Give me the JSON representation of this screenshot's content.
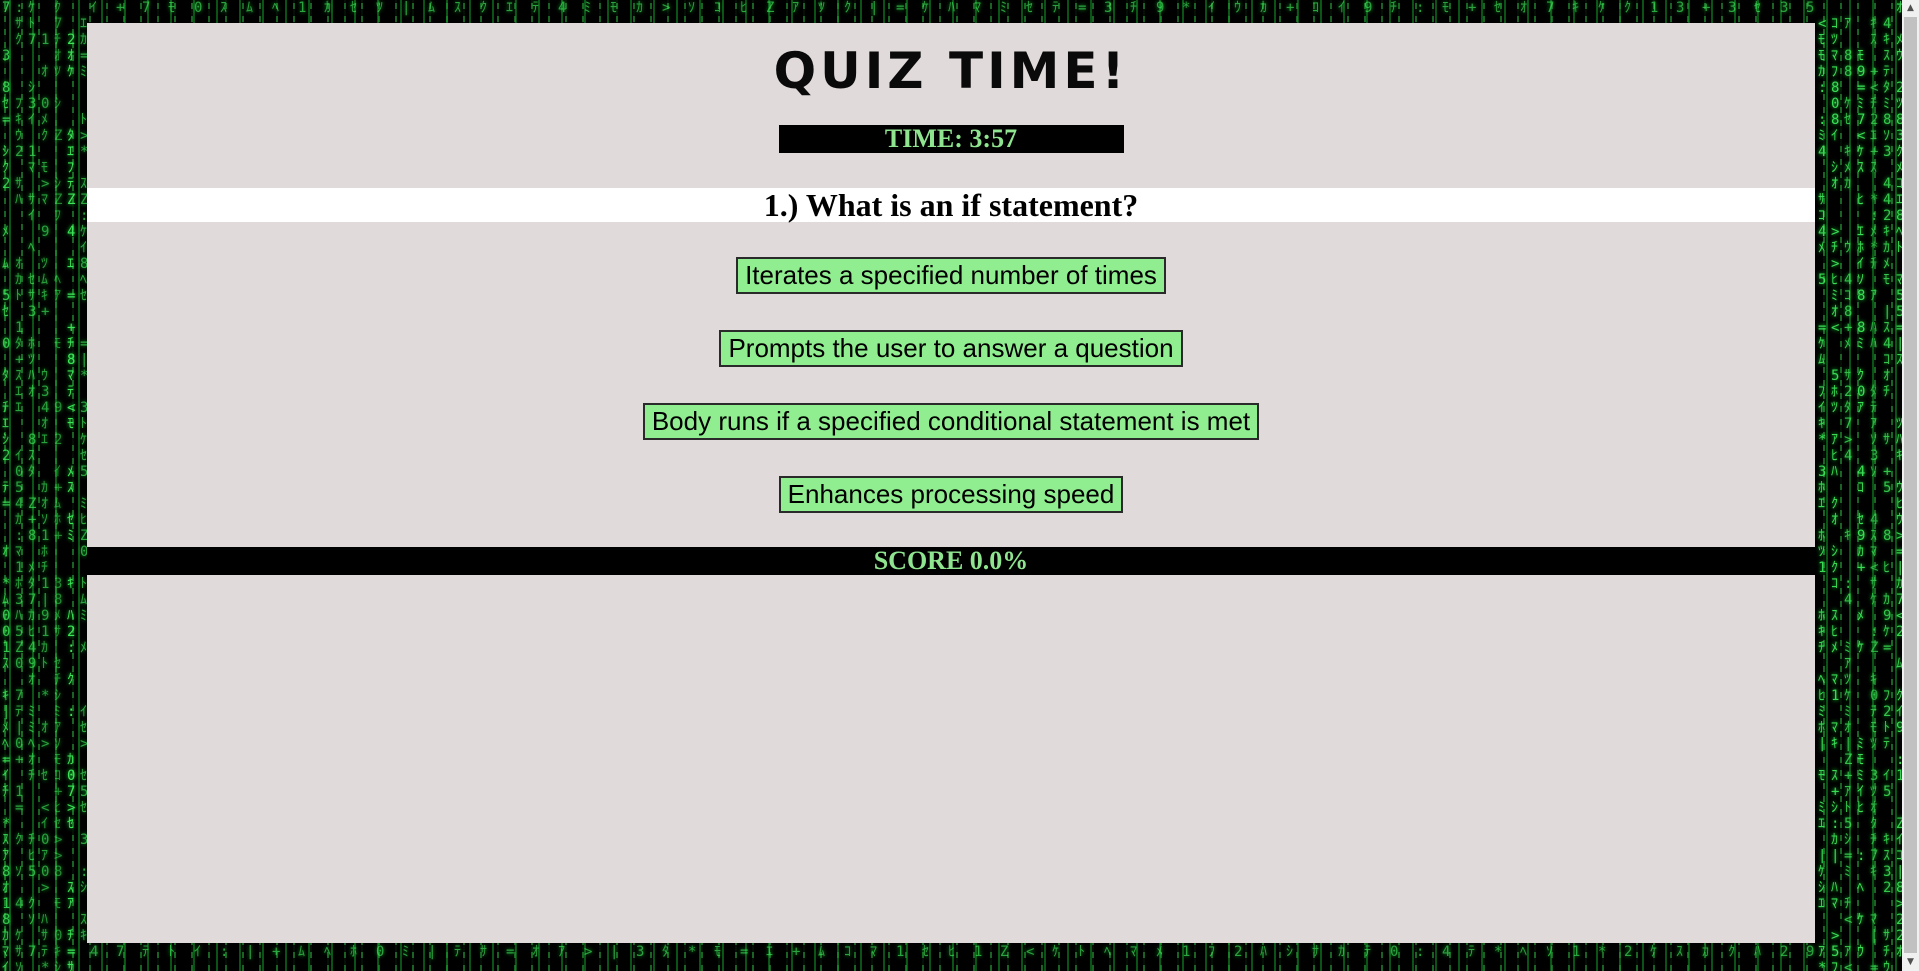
{
  "page": {
    "title": "QUIZ TIME!",
    "timer_text": "TIME: 3:57",
    "score_text": "SCORE 0.0%"
  },
  "question": {
    "text": "1.) What is an if statement?"
  },
  "answers": [
    {
      "label": "Iterates a specified number of times"
    },
    {
      "label": "Prompts the user to answer a question"
    },
    {
      "label": "Body runs if a specified conditional statement is met"
    },
    {
      "label": "Enhances processing speed"
    }
  ],
  "colors": {
    "panel_bg": "#e0dadb",
    "button_bg": "#90ee90",
    "bar_bg": "#000000",
    "bar_text": "#8fe58f",
    "matrix_green": "#3ee65a"
  },
  "icons": {
    "scroll_up": "▲",
    "scroll_down": "▼"
  }
}
